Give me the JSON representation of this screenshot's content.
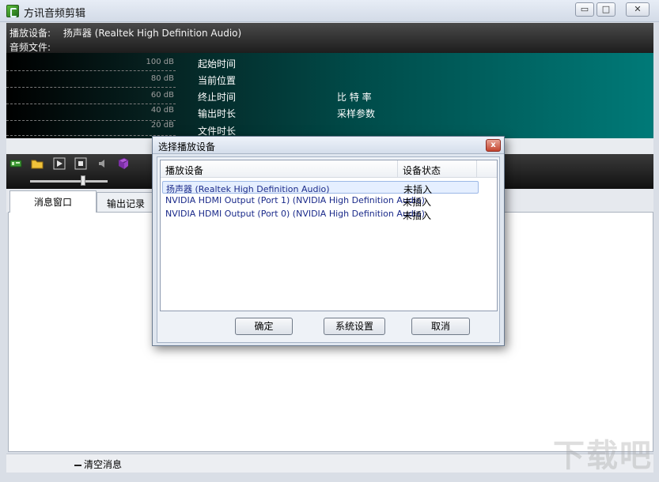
{
  "window": {
    "title": "方讯音频剪辑",
    "minimize": "▭",
    "maximize": "□",
    "close": "✕"
  },
  "device_bar": {
    "device_label": "播放设备:",
    "device_value": "扬声器 (Realtek High Definition Audio)",
    "file_label": "音频文件:"
  },
  "meter": {
    "db_labels": [
      "100 dB",
      "80 dB",
      "60 dB",
      "40 dB",
      "20 dB"
    ],
    "info_left": [
      "起始时间",
      "当前位置",
      "终止时间",
      "输出时长",
      "文件时长"
    ],
    "info_right": [
      "比 特 率",
      "采样参数"
    ]
  },
  "toolbar": {
    "icons": [
      "device-icon",
      "folder-icon",
      "play-icon",
      "stop-icon",
      "volume-icon",
      "book-icon"
    ],
    "volume_level": 0.68
  },
  "tabs": [
    "消息窗口",
    "输出记录"
  ],
  "bottom": {
    "clear_label": "清空消息"
  },
  "watermark": "下载吧",
  "dialog": {
    "title": "选择播放设备",
    "close": "x",
    "columns": [
      "播放设备",
      "设备状态"
    ],
    "rows": [
      {
        "device": "扬声器 (Realtek High Definition Audio)",
        "status": "未插入",
        "selected": true
      },
      {
        "device": "NVIDIA HDMI Output (Port 1) (NVIDIA High Definition Audio)",
        "status": "未插入",
        "selected": false
      },
      {
        "device": "NVIDIA HDMI Output (Port 0) (NVIDIA High Definition Audio)",
        "status": "未插入",
        "selected": false
      }
    ],
    "buttons": {
      "ok": "确定",
      "settings": "系统设置",
      "cancel": "取消"
    }
  }
}
